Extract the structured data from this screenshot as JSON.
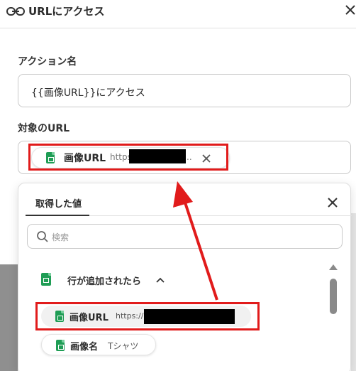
{
  "header": {
    "title": "URLにアクセス",
    "icon": "link-icon"
  },
  "action_name": {
    "label": "アクション名",
    "value": "{{画像URL}}にアクセス"
  },
  "target_url": {
    "label": "対象のURL",
    "chip": {
      "icon": "google-sheets-icon",
      "name": "画像URL",
      "value_prefix": "https",
      "value_suffix": ".."
    }
  },
  "picker": {
    "tab_label": "取得した値",
    "search_placeholder": "検索",
    "group": {
      "label": "行が追加されたら",
      "icon": "google-sheets-icon",
      "expanded": true
    },
    "items": [
      {
        "name": "画像URL",
        "value": "https://"
      },
      {
        "name": "画像名",
        "value": "Tシャツ"
      }
    ]
  },
  "colors": {
    "annotation_red": "#e11b1b",
    "sheets_green": "#1f9d55"
  }
}
